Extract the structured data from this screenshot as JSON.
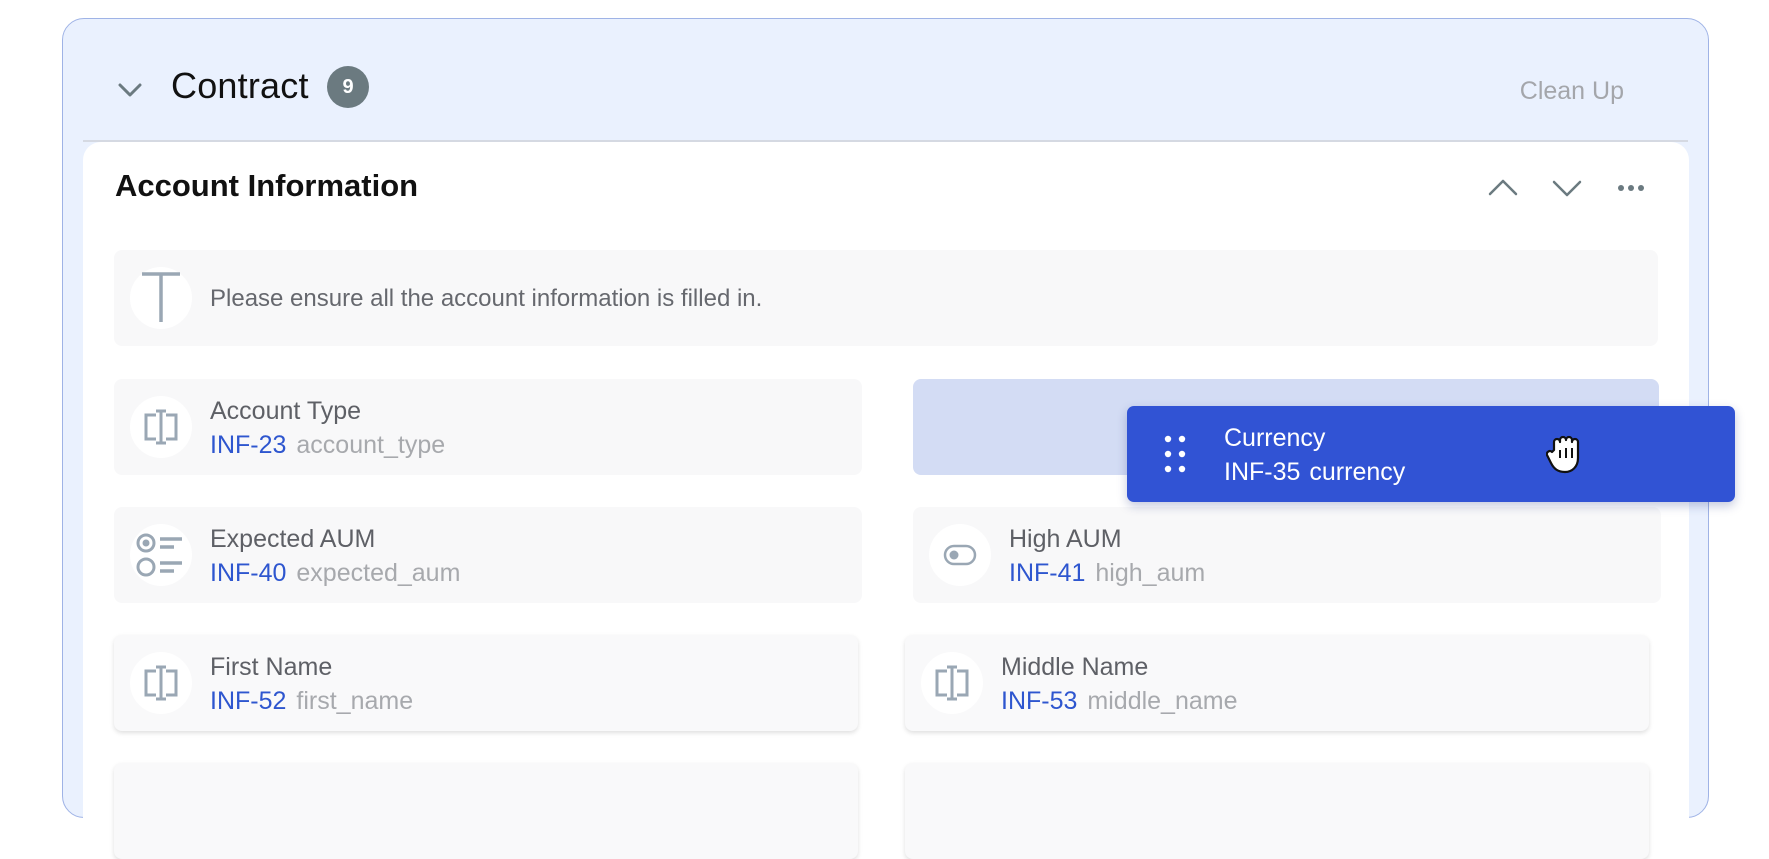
{
  "section": {
    "title": "Contract",
    "count": "9",
    "cleanup_label": "Clean Up"
  },
  "card": {
    "title": "Account Information",
    "note": "Please ensure all the account information is filled in."
  },
  "fields": [
    {
      "label": "Account Type",
      "id": "INF-23",
      "key": "account_type",
      "icon": "text-field-icon"
    },
    {
      "label": "Expected AUM",
      "id": "INF-40",
      "key": "expected_aum",
      "icon": "radio-list-icon"
    },
    {
      "label": "High AUM",
      "id": "INF-41",
      "key": "high_aum",
      "icon": "toggle-icon"
    },
    {
      "label": "First Name",
      "id": "INF-52",
      "key": "first_name",
      "icon": "text-field-icon"
    },
    {
      "label": "Middle Name",
      "id": "INF-53",
      "key": "middle_name",
      "icon": "text-field-icon"
    }
  ],
  "dragging": {
    "label": "Currency",
    "id": "INF-35",
    "key": "currency",
    "icon": "drag-handle-icon"
  },
  "colors": {
    "accent": "#3153d4",
    "id_text": "#2e56cf",
    "section_bg": "#eaf1fe",
    "drop_zone": "#d3dcf4",
    "badge": "#6b7a80"
  }
}
